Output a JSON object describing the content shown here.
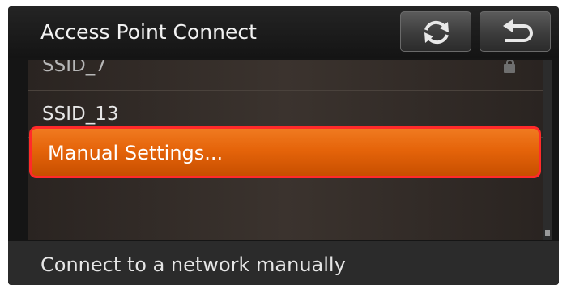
{
  "header": {
    "title": "Access Point Connect",
    "refresh_icon": "refresh-icon",
    "back_icon": "back-arrow-icon"
  },
  "list": {
    "items": [
      {
        "label": "SSID_7",
        "state": "partially-visible",
        "icon": "lock-icon"
      },
      {
        "label": "SSID_13",
        "state": "normal"
      },
      {
        "label": "Manual Settings...",
        "state": "selected"
      }
    ]
  },
  "footer": {
    "hint": "Connect to a network manually"
  },
  "colors": {
    "background": "#151515",
    "selection_fill": "#e5640a",
    "selection_outline": "#ff2a2a",
    "text": "#e6e6e6"
  }
}
